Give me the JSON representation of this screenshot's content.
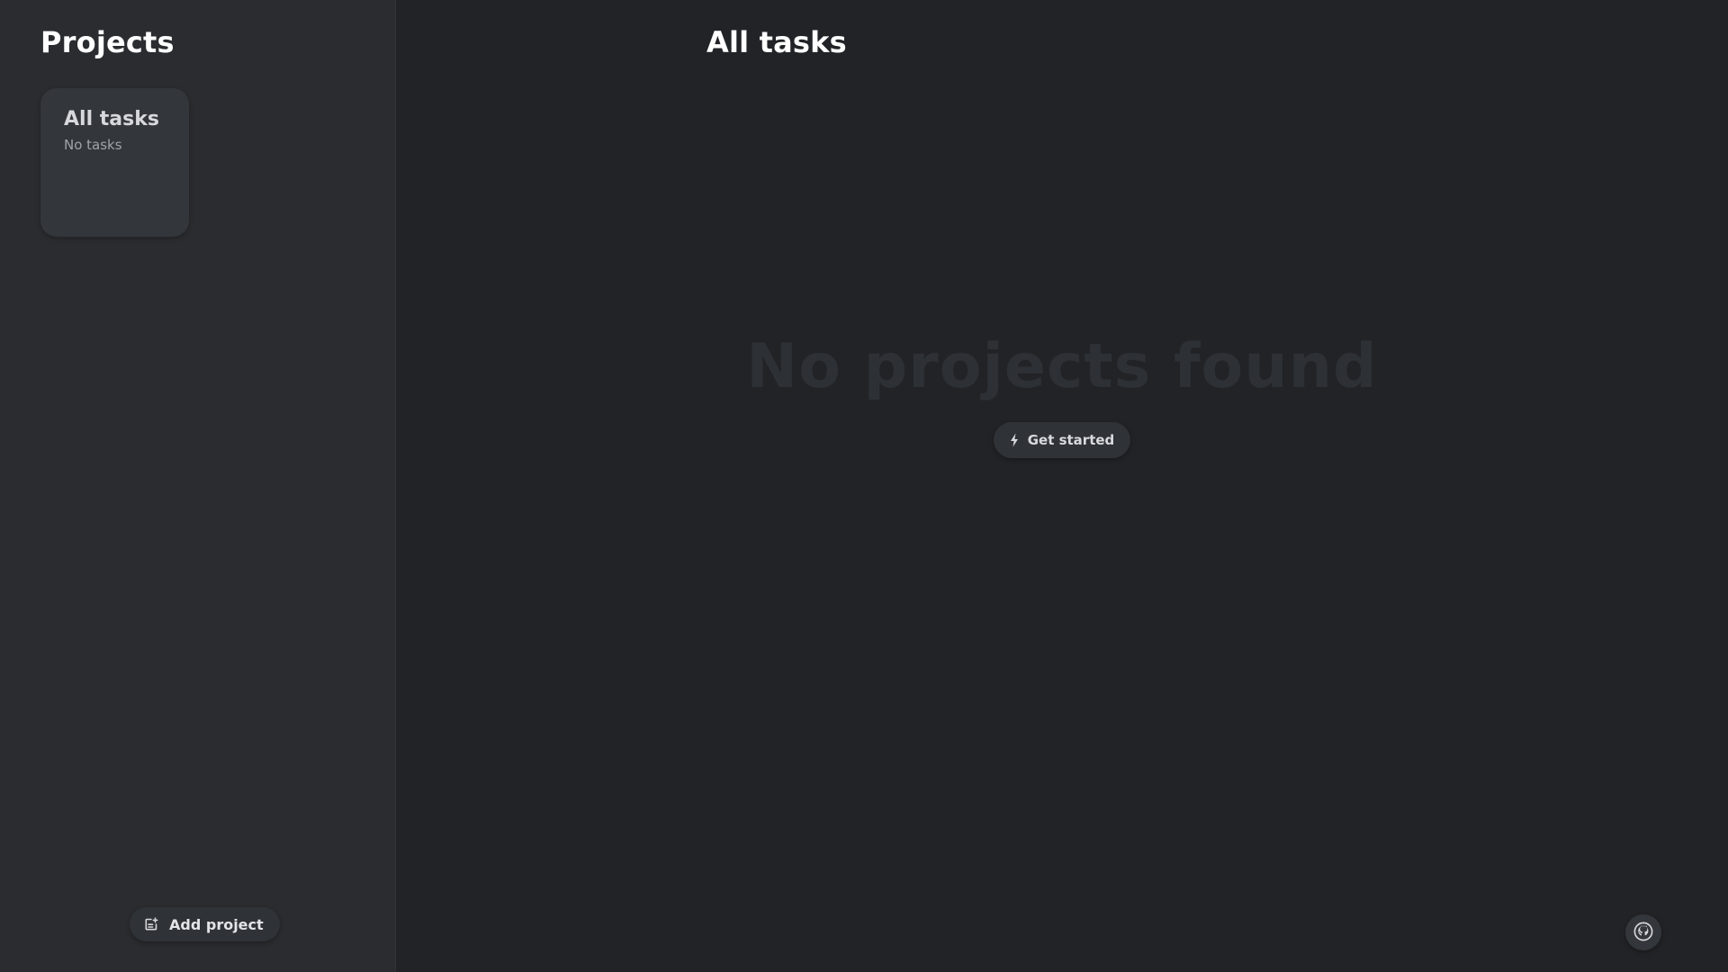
{
  "sidebar": {
    "title": "Projects",
    "cards": [
      {
        "title": "All tasks",
        "subtitle": "No tasks"
      }
    ],
    "add_project_label": "Add project",
    "add_project_icon": "add-note-icon"
  },
  "main": {
    "title": "All tasks",
    "empty_state": {
      "title": "No projects found",
      "button_label": "Get started",
      "button_icon": "lightning-bolt-icon"
    },
    "github_icon": "github-icon"
  },
  "colors": {
    "background": "#212327",
    "sidebar_background": "#2a2c30",
    "card_background": "#33363b",
    "empty_state_text": "#2d3035",
    "text_primary": "#ffffff"
  }
}
